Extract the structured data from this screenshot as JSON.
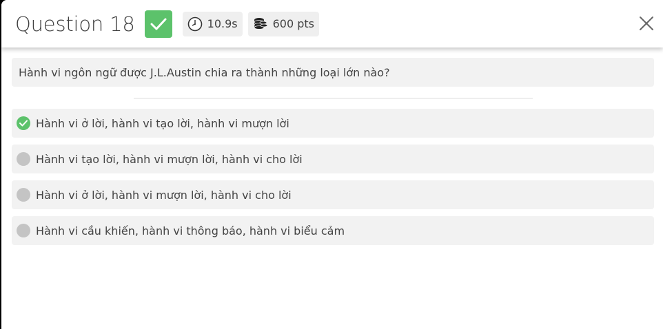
{
  "header": {
    "title": "Question 18",
    "timer": "10.9s",
    "points": "600 pts",
    "icons": [
      "check-icon",
      "clock-icon",
      "coins-icon",
      "close-icon"
    ]
  },
  "question": {
    "text": "Hành vi ngôn ngữ được J.L.Austin chia ra thành những loại lớn nào?"
  },
  "options": [
    {
      "text": "Hành vi ở lời, hành vi tạo lời, hành vi mượn lời",
      "correct": true
    },
    {
      "text": "Hành vi tạo lời, hành vi mượn lời, hành vi cho lời",
      "correct": false
    },
    {
      "text": "Hành vi ở lời, hành vi mượn lời, hành vi cho lời",
      "correct": false
    },
    {
      "text": "Hành vi cầu khiến, hành vi thông báo, hành vi biểu cảm",
      "correct": false
    }
  ],
  "colors": {
    "correct_green": "#5cc26b",
    "chip_bg": "#efefef",
    "option_bg": "#f2f2f2",
    "unselected_gray": "#c4c4c4"
  }
}
